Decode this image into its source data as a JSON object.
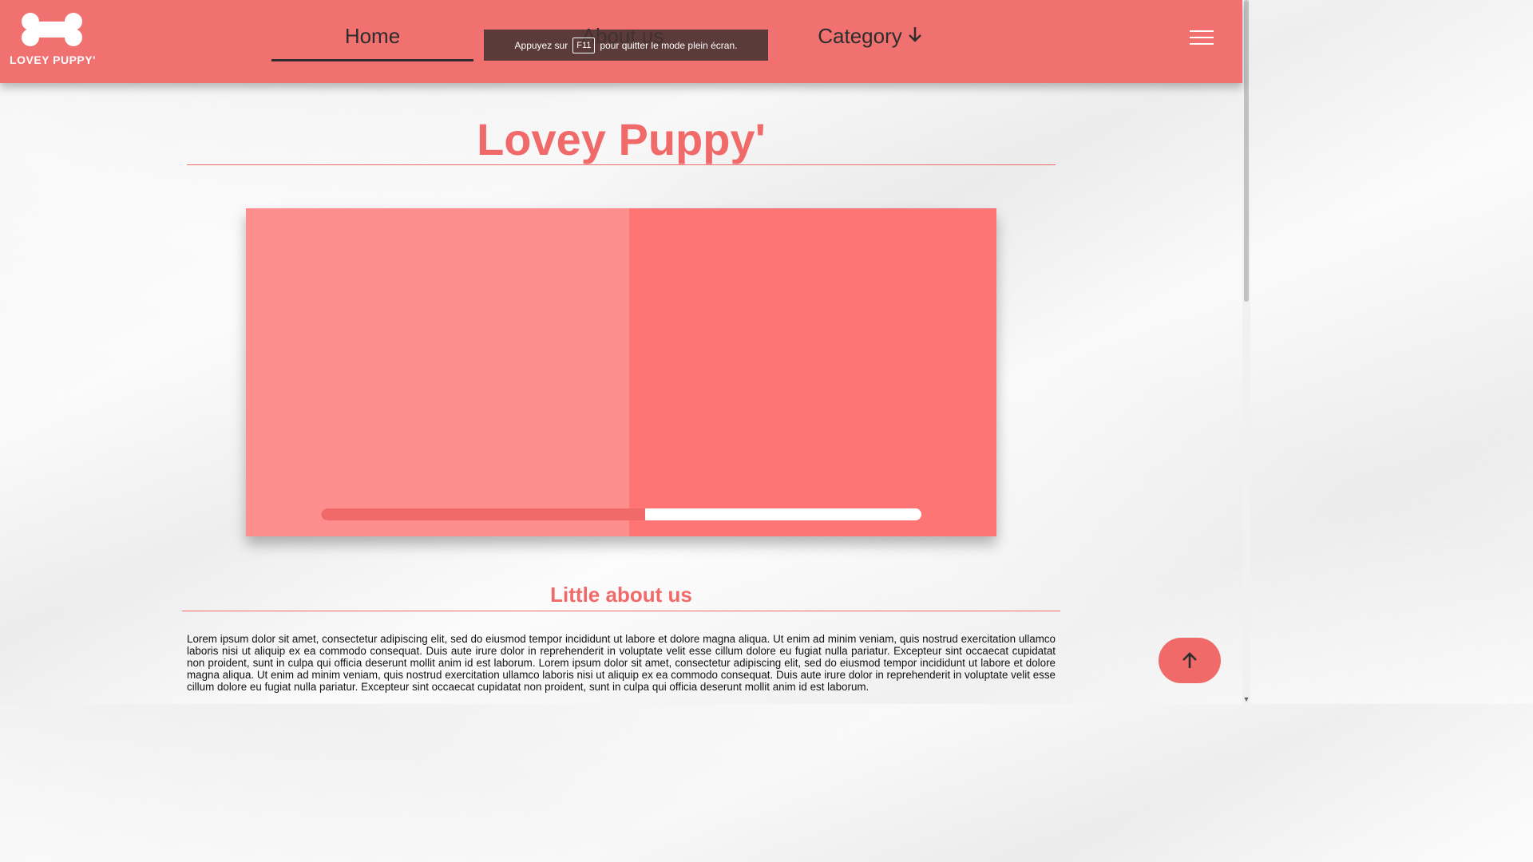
{
  "brand": {
    "logo_text": "LOVEY PUPPY'",
    "logo_icon": "bone-icon"
  },
  "nav": {
    "home": "Home",
    "about": "About us",
    "category": "Category",
    "category_icon": "arrow-down-icon",
    "menu_icon": "hamburger-icon"
  },
  "fullscreen_notice": {
    "before": "Appuyez sur",
    "key": "F11",
    "after": "pour quitter le mode plein écran."
  },
  "hero": {
    "title": "Lovey Puppy'"
  },
  "slider": {
    "progress": 0.54
  },
  "about": {
    "heading": "Little about us",
    "body": "Lorem ipsum dolor sit amet, consectetur adipiscing elit, sed do eiusmod tempor incididunt ut labore et dolore magna aliqua. Ut enim ad minim veniam, quis nostrud exercitation ullamco laboris nisi ut aliquip ex ea commodo consequat. Duis aute irure dolor in reprehenderit in voluptate velit esse cillum dolore eu fugiat nulla pariatur. Excepteur sint occaecat cupidatat non proident, sunt in culpa qui officia deserunt mollit anim id est laborum. Lorem ipsum dolor sit amet, consectetur adipiscing elit, sed do eiusmod tempor incididunt ut labore et dolore magna aliqua. Ut enim ad minim veniam, quis nostrud exercitation ullamco laboris nisi ut aliquip ex ea commodo consequat. Duis aute irure dolor in reprehenderit in voluptate velit esse cillum dolore eu fugiat nulla pariatur. Excepteur sint occaecat cupidatat non proident, sunt in culpa qui officia deserunt mollit anim id est laborum."
  },
  "back_to_top_icon": "arrow-up-icon",
  "colors": {
    "brand": "#f17070",
    "accent": "#f06a6a",
    "slide_left": "#fe8e8e",
    "slide_right": "#ff7575"
  }
}
